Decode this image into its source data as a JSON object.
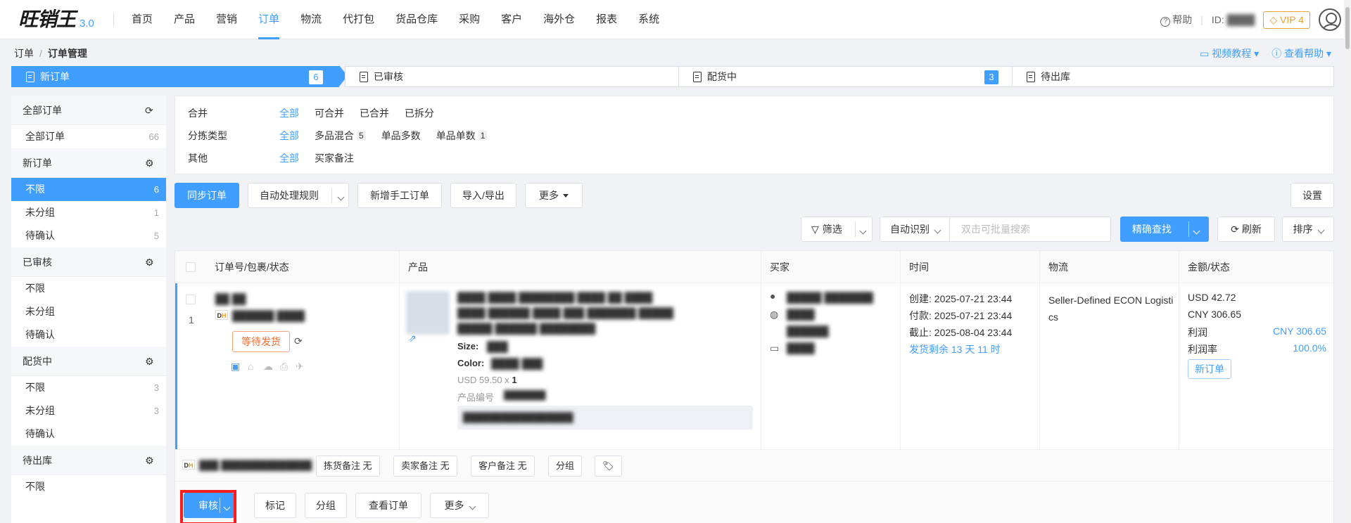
{
  "app": {
    "logo_text": "旺销王",
    "version": "3.0"
  },
  "nav": {
    "items": [
      "首页",
      "产品",
      "营销",
      "订单",
      "物流",
      "代打包",
      "货品仓库",
      "采购",
      "客户",
      "海外仓",
      "报表",
      "系统"
    ],
    "active": "订单"
  },
  "topright": {
    "help": "帮助",
    "id_label": "ID:",
    "vip": "VIP 4"
  },
  "breadcrumb": {
    "root": "订单",
    "sep": "/",
    "current": "订单管理"
  },
  "helplinks": {
    "video": "视频教程",
    "help": "查看帮助"
  },
  "steps": [
    {
      "label": "新订单",
      "count": "6"
    },
    {
      "label": "已审核",
      "count": ""
    },
    {
      "label": "配货中",
      "count": "3"
    },
    {
      "label": "待出库",
      "count": ""
    }
  ],
  "sidebar": {
    "groups": [
      {
        "title": "全部订单",
        "icon": "refresh-icon",
        "items": [
          {
            "label": "全部订单",
            "count": "66"
          }
        ]
      },
      {
        "title": "新订单",
        "icon": "gear-icon",
        "items": [
          {
            "label": "不限",
            "count": "6"
          },
          {
            "label": "未分组",
            "count": "1"
          },
          {
            "label": "待确认",
            "count": "5"
          }
        ]
      },
      {
        "title": "已审核",
        "icon": "gear-icon",
        "items": [
          {
            "label": "不限",
            "count": ""
          },
          {
            "label": "未分组",
            "count": ""
          },
          {
            "label": "待确认",
            "count": ""
          }
        ]
      },
      {
        "title": "配货中",
        "icon": "gear-icon",
        "items": [
          {
            "label": "不限",
            "count": "3"
          },
          {
            "label": "未分组",
            "count": "3"
          },
          {
            "label": "待确认",
            "count": ""
          }
        ]
      },
      {
        "title": "待出库",
        "icon": "gear-icon",
        "items": [
          {
            "label": "不限",
            "count": ""
          }
        ]
      }
    ]
  },
  "filters": {
    "merge": {
      "label": "合并",
      "options": [
        "全部",
        "可合并",
        "已合并",
        "已拆分"
      ]
    },
    "sort_type": {
      "label": "分拣类型",
      "options": [
        "全部",
        "多品混合",
        "单品多数",
        "单品单数"
      ],
      "counts": [
        "",
        "5",
        "",
        "1"
      ]
    },
    "other": {
      "label": "其他",
      "options": [
        "全部",
        "买家备注"
      ]
    }
  },
  "toolbar": {
    "sync": "同步订单",
    "auto_rule": "自动处理规则",
    "new_manual": "新增手工订单",
    "import_export": "导入/导出",
    "more": "更多",
    "settings": "设置"
  },
  "searchbar": {
    "filter": "筛选",
    "auto_detect": "自动识别",
    "placeholder": "双击可批量搜索",
    "exact_search": "精确查找",
    "refresh": "刷新",
    "sort": "排序"
  },
  "table": {
    "headers": [
      "订单号/包裹/状态",
      "产品",
      "买家",
      "时间",
      "物流",
      "金额/状态"
    ],
    "row": {
      "index": "1",
      "status": "等待发货",
      "product": {
        "size_label": "Size:",
        "color_label": "Color:",
        "price": "USD 59.50 x",
        "qty": "1",
        "sku_label": "产品编号"
      },
      "time": {
        "created_label": "创建:",
        "created": "2025-07-21 23:44",
        "paid_label": "付款:",
        "paid": "2025-07-21 23:44",
        "deadline_label": "截止:",
        "deadline": "2025-08-04 23:44",
        "remaining": "发货剩余 13 天 11 时"
      },
      "logistics": "Seller-Defined ECON Logistics",
      "amount": {
        "usd": "USD 42.72",
        "cny": "CNY 306.65",
        "profit_label": "利润",
        "profit": "CNY 306.65",
        "margin_label": "利润率",
        "margin": "100.0%",
        "status_tag": "新订单"
      }
    },
    "notes": {
      "picking": "拣货备注 无",
      "seller": "卖家备注 无",
      "customer": "客户备注 无",
      "group": "分组"
    },
    "actions": {
      "review": "审核",
      "mark": "标记",
      "group": "分组",
      "view": "查看订单",
      "more": "更多"
    }
  },
  "colors": {
    "accent": "#409eff",
    "warn": "#f56c2d",
    "highlight_frame": "#ff1c1c"
  }
}
